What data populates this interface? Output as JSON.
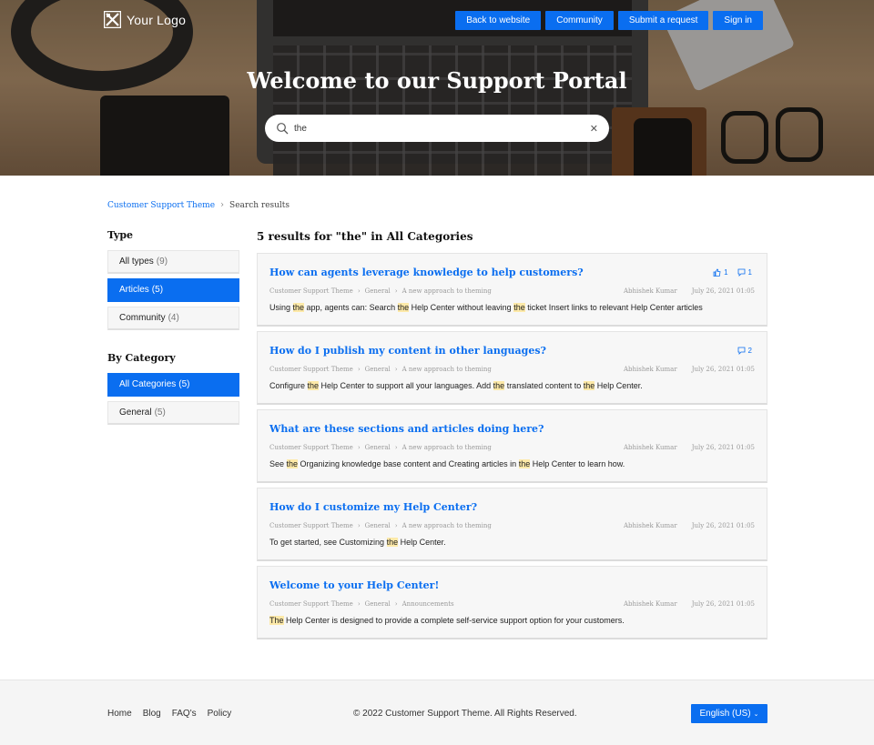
{
  "brand": {
    "logo_text": "Your Logo"
  },
  "nav": [
    {
      "label": "Back to website"
    },
    {
      "label": "Community"
    },
    {
      "label": "Submit a request"
    },
    {
      "label": "Sign in"
    }
  ],
  "hero": {
    "title": "Welcome to our Support Portal"
  },
  "search": {
    "value": "the",
    "placeholder": "Search"
  },
  "breadcrumb": {
    "home": "Customer Support Theme",
    "current": "Search results"
  },
  "sidebar": {
    "type_heading": "Type",
    "types": [
      {
        "label": "All types",
        "count": "(9)"
      },
      {
        "label": "Articles",
        "count": "(5)"
      },
      {
        "label": "Community",
        "count": "(4)"
      }
    ],
    "category_heading": "By Category",
    "categories": [
      {
        "label": "All Categories",
        "count": "(5)"
      },
      {
        "label": "General",
        "count": "(5)"
      }
    ]
  },
  "results": {
    "heading": "5 results for \"the\" in All Categories",
    "items": [
      {
        "title": "How can agents leverage knowledge to help customers?",
        "votes": "1",
        "comments": "1",
        "path": [
          "Customer Support Theme",
          "General",
          "A new approach to theming"
        ],
        "author": "Abhishek Kumar",
        "date": "July 26, 2021 01:05",
        "snippet": [
          "Using ",
          "the",
          " app, agents can: Search ",
          "the",
          " Help Center without leaving ",
          "the",
          " ticket Insert links to relevant Help Center articles"
        ]
      },
      {
        "title": "How do I publish my content in other languages?",
        "comments": "2",
        "path": [
          "Customer Support Theme",
          "General",
          "A new approach to theming"
        ],
        "author": "Abhishek Kumar",
        "date": "July 26, 2021 01:05",
        "snippet": [
          "Configure ",
          "the",
          " Help Center to support all your languages. Add ",
          "the",
          " translated content to ",
          "the",
          " Help Center."
        ]
      },
      {
        "title": "What are these sections and articles doing here?",
        "path": [
          "Customer Support Theme",
          "General",
          "A new approach to theming"
        ],
        "author": "Abhishek Kumar",
        "date": "July 26, 2021 01:05",
        "snippet": [
          "See ",
          "the",
          " Organizing knowledge base content and Creating articles in ",
          "the",
          " Help Center to learn how."
        ]
      },
      {
        "title": "How do I customize my Help Center?",
        "path": [
          "Customer Support Theme",
          "General",
          "A new approach to theming"
        ],
        "author": "Abhishek Kumar",
        "date": "July 26, 2021 01:05",
        "snippet": [
          "To get started, see Customizing ",
          "the",
          " Help Center."
        ]
      },
      {
        "title": "Welcome to your Help Center!",
        "path": [
          "Customer Support Theme",
          "General",
          "Announcements"
        ],
        "author": "Abhishek Kumar",
        "date": "July 26, 2021 01:05",
        "snippet": [
          "",
          "The",
          " Help Center is designed to provide a complete self-service support option for your customers."
        ]
      }
    ]
  },
  "footer": {
    "links": [
      "Home",
      "Blog",
      "FAQ's",
      "Policy"
    ],
    "copyright": "© 2022 Customer Support Theme. All Rights Reserved.",
    "language": "English (US)"
  },
  "colors": {
    "accent": "#0a6ef0",
    "highlight": "#fde9a8"
  }
}
